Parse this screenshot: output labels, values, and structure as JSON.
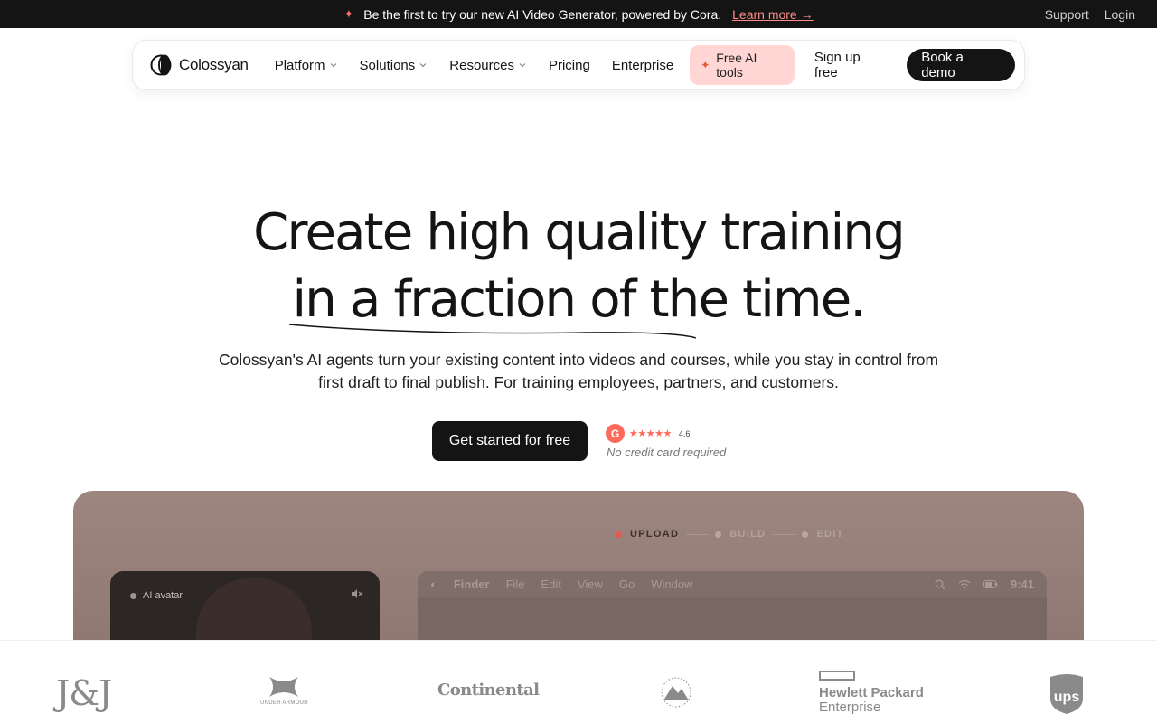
{
  "announcement": {
    "text": "Be the first to try our new AI Video Generator, powered by Cora.",
    "link": "Learn more →",
    "support": "Support",
    "login": "Login"
  },
  "nav": {
    "brand": "Colossyan",
    "items": [
      {
        "label": "Platform"
      },
      {
        "label": "Solutions"
      },
      {
        "label": "Resources"
      },
      {
        "label": "Pricing"
      },
      {
        "label": "Enterprise"
      }
    ],
    "free_tools": "Free AI tools",
    "signup": "Sign up free",
    "book_demo": "Book a demo"
  },
  "hero": {
    "title_line1": "Create high quality training",
    "title_line2": "in a fraction of the time.",
    "subtitle_line1": "Colossyan's AI agents turn your existing content into videos and courses, while you stay in control from",
    "subtitle_line2": "first draft to final publish. For training employees, partners, and customers.",
    "cta": "Get started for free",
    "rating_badge": "G",
    "rating": "4.6",
    "no_card": "No credit card required"
  },
  "demo": {
    "steps": [
      "UPLOAD",
      "BUILD",
      "EDIT"
    ],
    "active_step": "UPLOAD",
    "avatar_label": "AI avatar",
    "finder_menu": [
      "Finder",
      "File",
      "Edit",
      "View",
      "Go",
      "Window"
    ],
    "clock": "9:41"
  },
  "logos": {
    "jj": "J&J",
    "under_armour": "UNDER ARMOUR",
    "continental": "Continental",
    "hpe_line1": "Hewlett Packard",
    "hpe_line2": "Enterprise",
    "ups": "ups"
  },
  "colors": {
    "dark": "#141414",
    "accent_red": "#ff6a5a",
    "free_tools_bg": "#ffd6d3"
  }
}
